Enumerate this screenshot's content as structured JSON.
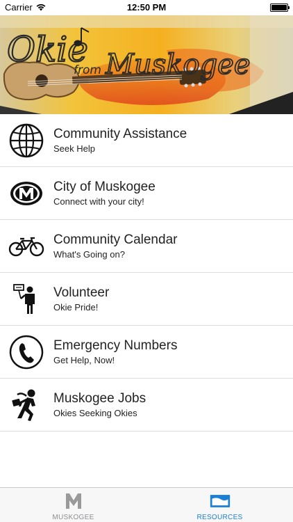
{
  "status_bar": {
    "carrier": "Carrier",
    "time": "12:50 PM"
  },
  "banner": {
    "title": "Okie",
    "subtitle_from": "from",
    "subtitle_place": "Muskogee"
  },
  "list": [
    {
      "title": "Community Assistance",
      "subtitle": "Seek Help",
      "icon": "globe-icon"
    },
    {
      "title": "City of Muskogee",
      "subtitle": "Connect with your city!",
      "icon": "muskogee-m-logo-icon"
    },
    {
      "title": "Community Calendar",
      "subtitle": "What's Going on?",
      "icon": "bicycle-icon"
    },
    {
      "title": "Volunteer",
      "subtitle": "Okie Pride!",
      "icon": "person-with-sign-icon"
    },
    {
      "title": "Emergency Numbers",
      "subtitle": "Get Help, Now!",
      "icon": "phone-icon"
    },
    {
      "title": "Muskogee Jobs",
      "subtitle": "Okies Seeking Okies",
      "icon": "running-person-icon"
    }
  ],
  "tab_bar": {
    "tabs": [
      {
        "label": "MUSKOGEE",
        "icon": "m-icon",
        "active": false
      },
      {
        "label": "RESOURCES",
        "icon": "resources-icon",
        "active": true
      }
    ]
  },
  "colors": {
    "active_tab": "#1a7fd6",
    "inactive_tab": "#8e8e93",
    "divider": "#dedede"
  }
}
